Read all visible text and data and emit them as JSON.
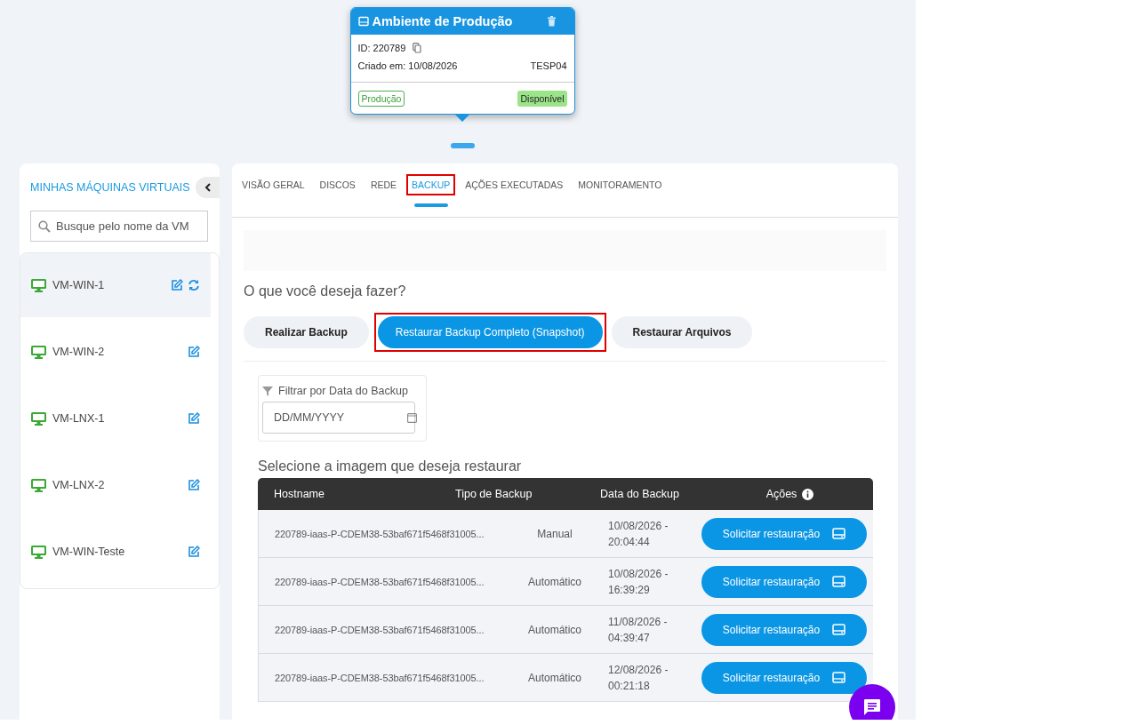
{
  "environment_card": {
    "title": "Ambiente de Produção",
    "id": "ID: 220789",
    "created": "Criado em: 10/08/2026",
    "code": "TESP04",
    "tag": "Produção",
    "status": "Disponível"
  },
  "sidebar": {
    "title": "MINHAS MÁQUINAS VIRTUAIS",
    "search": {
      "placeholder": "Busque pelo nome da VM"
    },
    "items": [
      {
        "name": "VM-WIN-1",
        "selected": true,
        "sync_icon": true
      },
      {
        "name": "VM-WIN-2",
        "selected": false,
        "sync_icon": false
      },
      {
        "name": "VM-LNX-1",
        "selected": false,
        "sync_icon": false
      },
      {
        "name": "VM-LNX-2",
        "selected": false,
        "sync_icon": false
      },
      {
        "name": "VM-WIN-Teste",
        "selected": false,
        "sync_icon": false
      }
    ]
  },
  "tabs": [
    {
      "label": "VISÃO GERAL",
      "selected": false,
      "highlighted": false
    },
    {
      "label": "DISCOS",
      "selected": false,
      "highlighted": false
    },
    {
      "label": "REDE",
      "selected": false,
      "highlighted": false
    },
    {
      "label": "BACKUP",
      "selected": true,
      "highlighted": true
    },
    {
      "label": "AÇÕES EXECUTADAS",
      "selected": false,
      "highlighted": false
    },
    {
      "label": "MONITORAMENTO",
      "selected": false,
      "highlighted": false
    }
  ],
  "question": "O que você deseja fazer?",
  "actions": [
    {
      "label": "Realizar Backup",
      "selected": false,
      "highlighted": false
    },
    {
      "label": "Restaurar Backup Completo (Snapshot)",
      "selected": true,
      "highlighted": true
    },
    {
      "label": "Restaurar Arquivos",
      "selected": false,
      "highlighted": false
    }
  ],
  "filter": {
    "label": "Filtrar por Data do Backup",
    "placeholder": "DD/MM/YYYY"
  },
  "table": {
    "title": "Selecione a imagem que deseja restaurar",
    "columns": [
      "Hostname",
      "Tipo de Backup",
      "Data do Backup",
      "Ações"
    ],
    "rows": [
      {
        "hostname": "220789-iaas-P-CDEM38-53baf671f5468f31005...",
        "type": "Manual",
        "date": "10/08/2026 -",
        "time": "20:04:44",
        "action": "Solicitar restauração"
      },
      {
        "hostname": "220789-iaas-P-CDEM38-53baf671f5468f31005...",
        "type": "Automático",
        "date": "10/08/2026 -",
        "time": "16:39:29",
        "action": "Solicitar restauração"
      },
      {
        "hostname": "220789-iaas-P-CDEM38-53baf671f5468f31005...",
        "type": "Automático",
        "date": "11/08/2026 -",
        "time": "04:39:47",
        "action": "Solicitar restauração"
      },
      {
        "hostname": "220789-iaas-P-CDEM38-53baf671f5468f31005...",
        "type": "Automático",
        "date": "12/08/2026 -",
        "time": "00:21:18",
        "action": "Solicitar restauração"
      }
    ]
  }
}
